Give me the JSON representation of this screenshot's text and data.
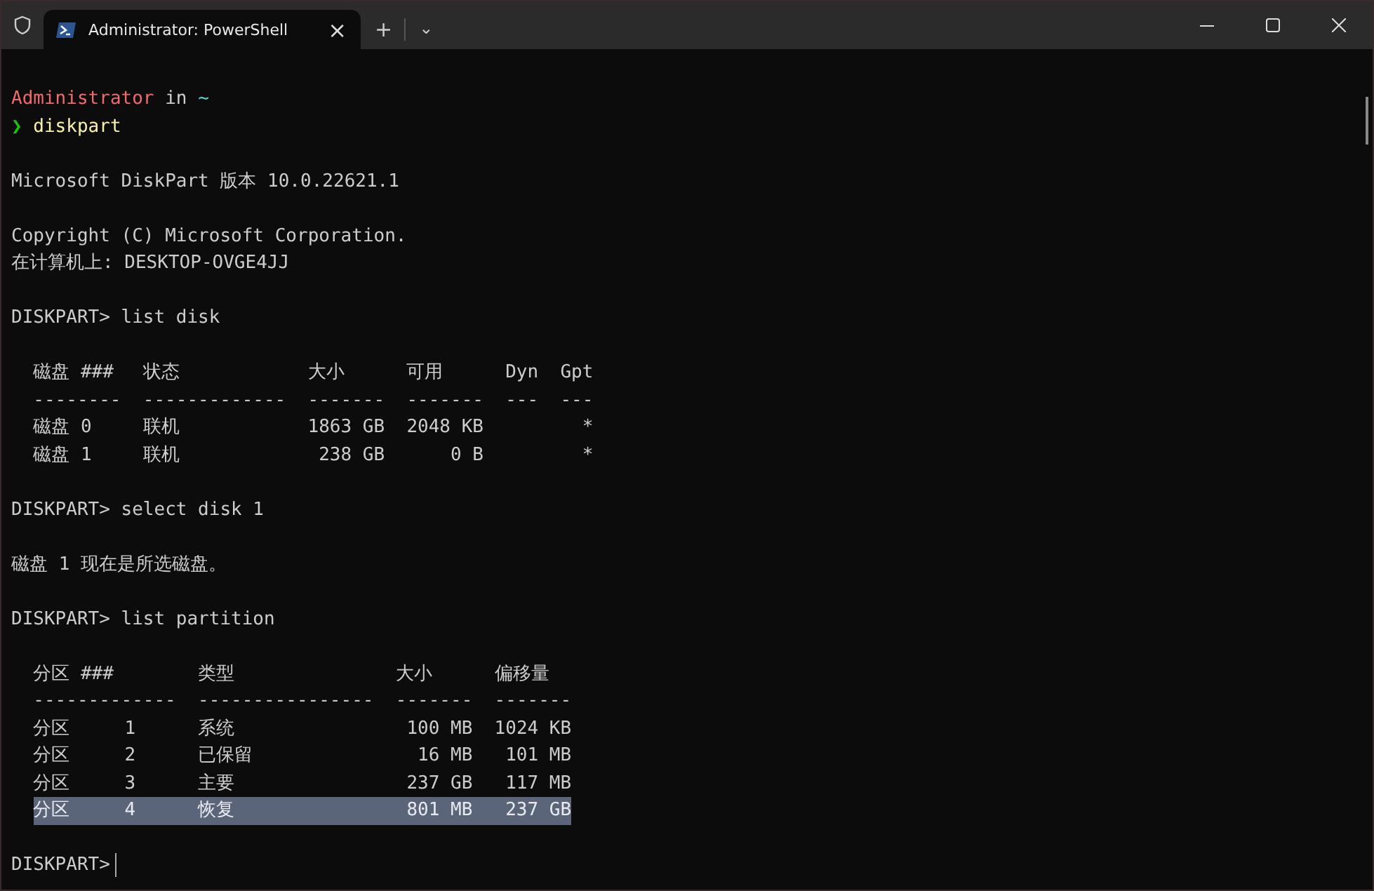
{
  "window": {
    "tab": {
      "title": "Administrator: PowerShell",
      "close": "×",
      "selected": true
    },
    "new_tab": "+",
    "dropdown": "⌄"
  },
  "terminal": {
    "lines": [
      {
        "kind": "segments",
        "segments": [
          {
            "text": "Administrator",
            "color": "#f06a6a"
          },
          {
            "text": " in ",
            "color": "#cccccc"
          },
          {
            "text": "~",
            "color": "#61d6d6"
          }
        ]
      },
      {
        "kind": "segments",
        "segments": [
          {
            "text": "❯",
            "color": "#16c60c"
          },
          {
            "text": " diskpart",
            "color": "#f9f1a5"
          }
        ]
      },
      {
        "kind": "blank"
      },
      {
        "kind": "text",
        "text": "Microsoft DiskPart 版本 10.0.22621.1"
      },
      {
        "kind": "blank"
      },
      {
        "kind": "text",
        "text": "Copyright (C) Microsoft Corporation."
      },
      {
        "kind": "text",
        "text": "在计算机上: DESKTOP-OVGE4JJ"
      },
      {
        "kind": "blank"
      },
      {
        "kind": "text",
        "text": "DISKPART> list disk"
      },
      {
        "kind": "blank"
      },
      {
        "kind": "table",
        "columns": [
          {
            "header": "磁盘 ###",
            "rule": "--------"
          },
          {
            "header": "状态",
            "rule": "-------------"
          },
          {
            "header": "大小",
            "rule": "-------"
          },
          {
            "header": "可用",
            "rule": "-------"
          },
          {
            "header": "Dyn",
            "rule": "---"
          },
          {
            "header": "Gpt",
            "rule": "---"
          }
        ],
        "rows": [
          {
            "cells": [
              "磁盘 0",
              "联机",
              "1863 GB",
              "2048 KB",
              null,
              "*"
            ],
            "selected": false
          },
          {
            "cells": [
              "磁盘 1",
              "联机",
              "238 GB",
              "0 B",
              null,
              "*"
            ],
            "selected": false
          }
        ]
      },
      {
        "kind": "blank"
      },
      {
        "kind": "text",
        "text": "DISKPART> select disk 1"
      },
      {
        "kind": "blank"
      },
      {
        "kind": "text",
        "text": "磁盘 1 现在是所选磁盘。"
      },
      {
        "kind": "blank"
      },
      {
        "kind": "text",
        "text": "DISKPART> list partition"
      },
      {
        "kind": "blank"
      },
      {
        "kind": "table",
        "columns": [
          {
            "header": "分区 ###",
            "rule": "-------------"
          },
          {
            "header": "类型",
            "rule": "----------------"
          },
          {
            "header": "大小",
            "rule": "-------"
          },
          {
            "header": "偏移量",
            "rule": "-------"
          }
        ],
        "rows": [
          {
            "cells": [
              "分区     1",
              "系统",
              "100 MB",
              "1024 KB"
            ],
            "selected": false
          },
          {
            "cells": [
              "分区     2",
              "已保留",
              "16 MB",
              "101 MB"
            ],
            "selected": false
          },
          {
            "cells": [
              "分区     3",
              "主要",
              "237 GB",
              "117 MB"
            ],
            "selected": false
          },
          {
            "cells": [
              "分区     4",
              "恢复",
              "801 MB",
              "237 GB"
            ],
            "selected": true
          }
        ]
      },
      {
        "kind": "blank"
      },
      {
        "kind": "input",
        "text": "DISKPART>"
      }
    ]
  }
}
